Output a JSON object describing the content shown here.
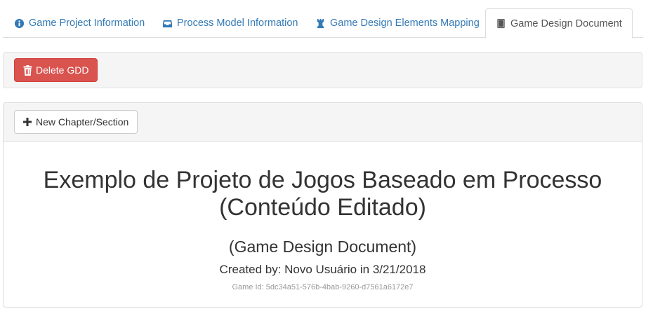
{
  "tabs": [
    {
      "label": "Game Project Information",
      "icon": "info-circle-icon"
    },
    {
      "label": "Process Model Information",
      "icon": "inbox-icon"
    },
    {
      "label": "Game Design Elements Mapping",
      "icon": "chess-rook-icon"
    },
    {
      "label": "Game Design Document",
      "icon": "book-icon"
    }
  ],
  "actions": {
    "delete_label": "Delete GDD"
  },
  "chapter": {
    "new_label": "New Chapter/Section"
  },
  "document": {
    "title_line1": "Exemplo de Projeto de Jogos Baseado em Processo",
    "title_line2": "(Conteúdo Editado)",
    "subtitle": "(Game Design Document)",
    "created": "Created by: Novo Usuário in 3/21/2018",
    "game_id": "Game Id: 5dc34a51-576b-4bab-9260-d7561a6172e7"
  },
  "colors": {
    "link": "#337ab7",
    "danger": "#d9534f",
    "panel_bg": "#f5f5f5",
    "muted": "#999999"
  }
}
